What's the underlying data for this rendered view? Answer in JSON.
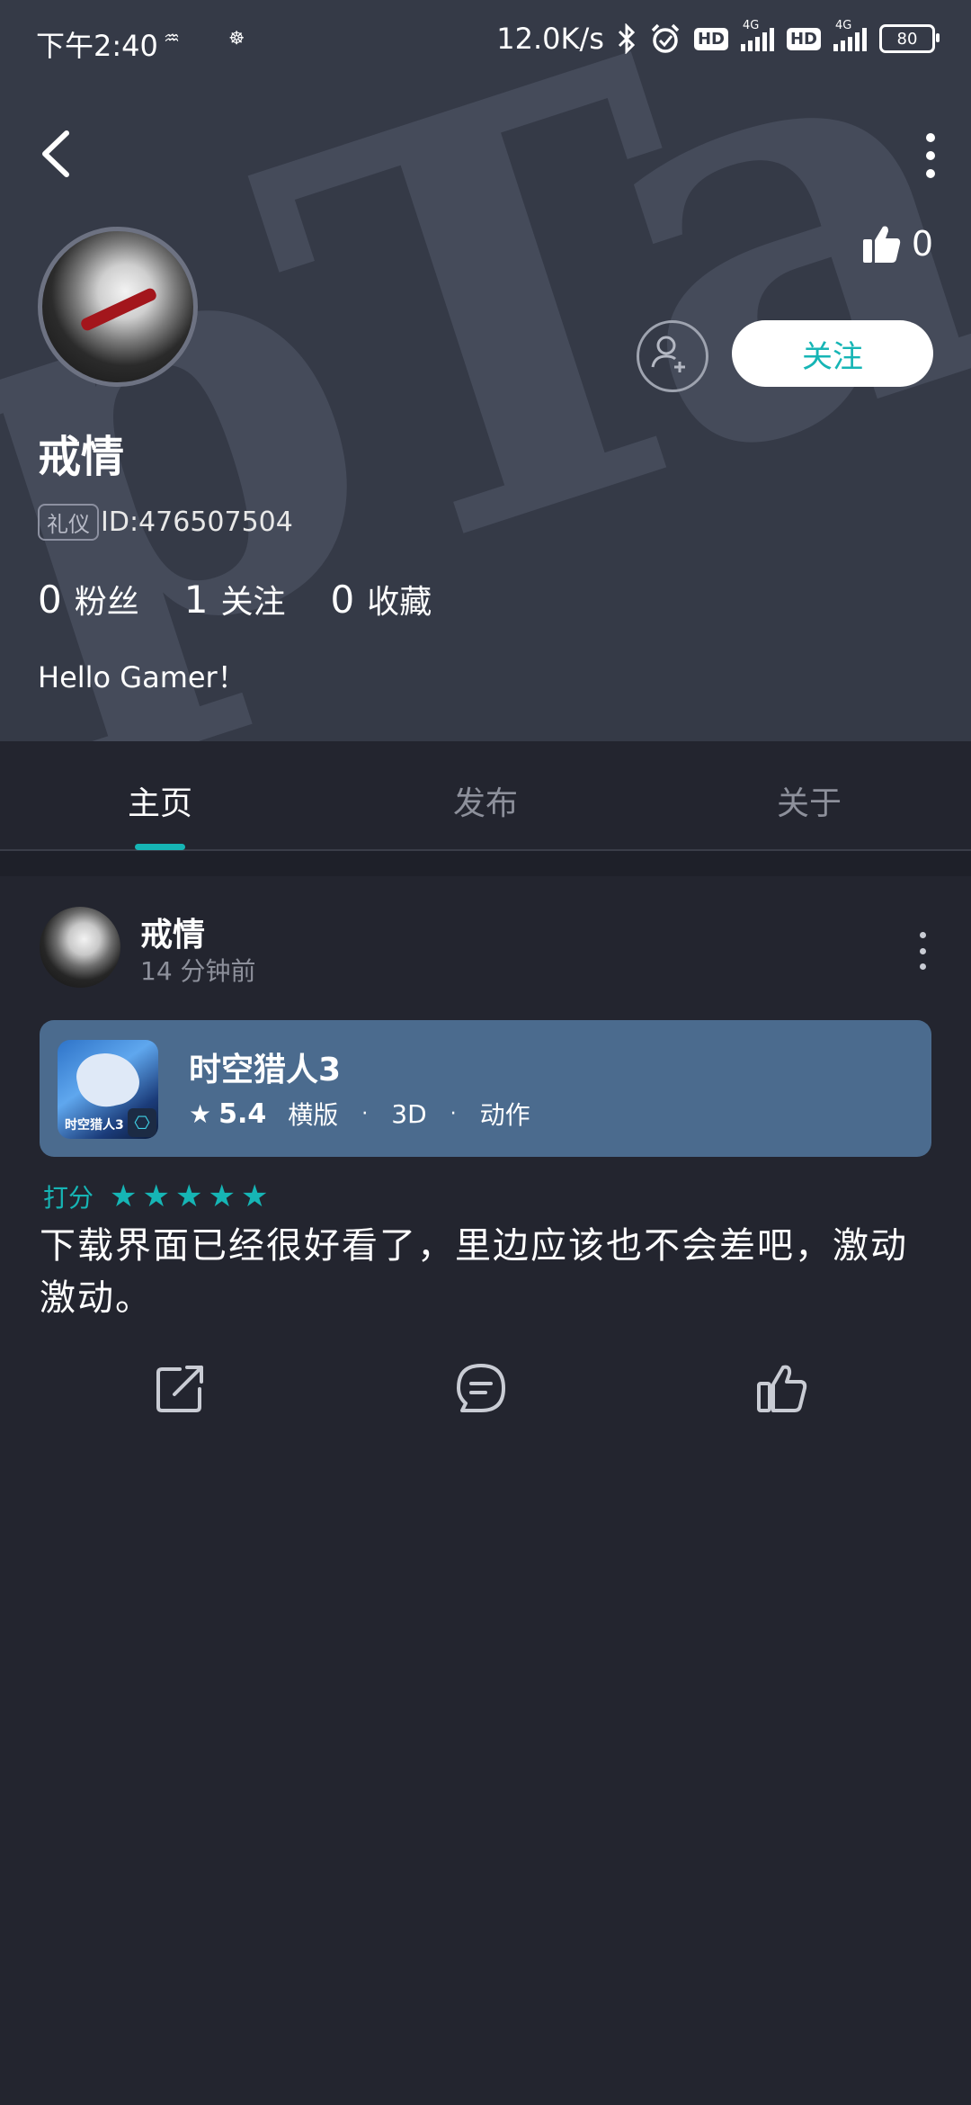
{
  "status_bar": {
    "time": "下午2:40",
    "left_icons": "♒ ☸",
    "network_speed": "12.0K/s",
    "hd1": "HD",
    "hd2": "HD",
    "net_type": "4G",
    "battery": "80"
  },
  "profile": {
    "watermark": "pTa",
    "likes": "0",
    "follow_label": "关注",
    "username": "戒情",
    "id_badge": "礼仪",
    "id_text": "ID:476507504",
    "stats": [
      {
        "num": "0",
        "label": "粉丝"
      },
      {
        "num": "1",
        "label": "关注"
      },
      {
        "num": "0",
        "label": "收藏"
      }
    ],
    "bio": "Hello Gamer！"
  },
  "tabs": [
    {
      "label": "主页",
      "active": true
    },
    {
      "label": "发布",
      "active": false
    },
    {
      "label": "关于",
      "active": false
    }
  ],
  "post": {
    "author": "戒情",
    "time": "14 分钟前",
    "game": {
      "icon_text": "时空猎人3",
      "title": "时空猎人3",
      "score": "5.4",
      "tags": [
        "横版",
        "3D",
        "动作"
      ]
    },
    "rating_label": "打分",
    "rating_stars": 5,
    "text": "下载界面已经很好看了，里边应该也不会差吧，激动激动。"
  },
  "colors": {
    "accent": "#16b5b5",
    "header_bg": "#353a47",
    "page_bg": "#23252f",
    "card_bg": "#4b6b8e"
  },
  "icons": {
    "back": "back-arrow-icon",
    "more": "more-vertical-icon",
    "thumb": "thumbs-up-icon",
    "add_friend": "add-user-icon",
    "share": "share-icon",
    "comment": "comment-icon",
    "like": "like-icon"
  }
}
